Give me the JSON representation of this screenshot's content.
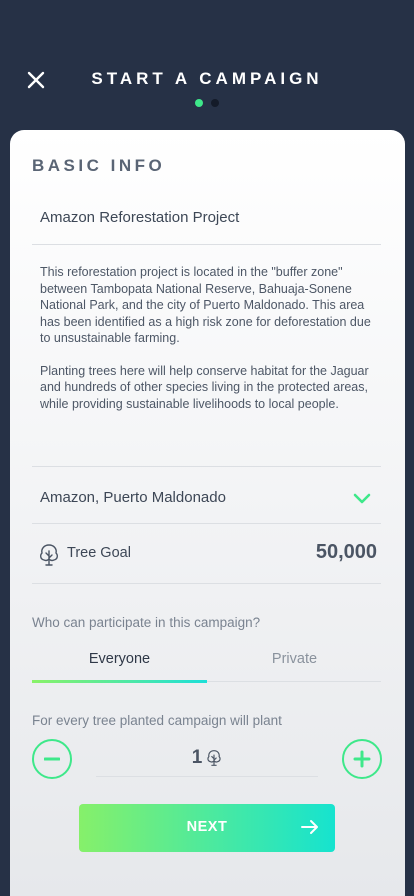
{
  "header": {
    "title": "START A CAMPAIGN",
    "close_icon": "close-icon",
    "steps": {
      "total": 2,
      "current": 1
    }
  },
  "colors": {
    "background": "#263146",
    "accent_green": "#3ee88a",
    "gradient_start": "#86f06a",
    "gradient_end": "#16e3cf"
  },
  "form": {
    "section_title": "BASIC INFO",
    "campaign_name": "Amazon Reforestation Project",
    "description": [
      "This reforestation project is located in the \"buffer zone\" between Tambopata National Reserve, Bahuaja-Sonene National Park, and the city of Puerto Maldonado. This area has been identified as a high risk zone for deforestation due to unsustainable farming.",
      "Planting trees here will help conserve habitat for the Jaguar and hundreds of other species living in the protected areas, while providing sustainable livelihoods to local people."
    ],
    "location": {
      "value": "Amazon, Puerto Maldonado",
      "icon": "chevron-down-icon"
    },
    "tree_goal": {
      "label": "Tree Goal",
      "value": "50,000",
      "icon": "tree-icon"
    },
    "participation": {
      "question": "Who can participate in this campaign?",
      "tabs": [
        {
          "label": "Everyone",
          "selected": true
        },
        {
          "label": "Private",
          "selected": false
        }
      ]
    },
    "plant_ratio": {
      "label": "For every tree planted campaign will plant",
      "value": "1",
      "minus_icon": "minus-icon",
      "plus_icon": "plus-icon",
      "unit_icon": "tree-icon"
    },
    "next_button": {
      "label": "NEXT",
      "icon": "arrow-right-icon"
    }
  }
}
